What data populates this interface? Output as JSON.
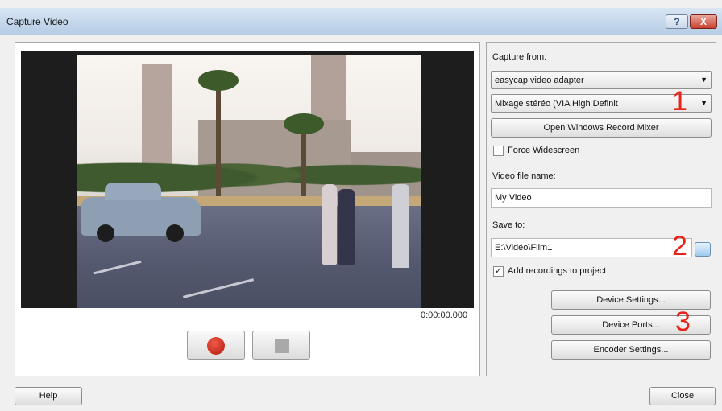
{
  "window": {
    "title": "Capture Video",
    "help_glyph": "?",
    "close_glyph": "X"
  },
  "preview": {
    "timecode": "0:00:00.000"
  },
  "settings": {
    "capture_from_label": "Capture from:",
    "video_source": "easycap video adapter",
    "audio_source": "Mixage stéréo (VIA High Definit",
    "open_mixer_label": "Open Windows Record Mixer",
    "force_widescreen_label": "Force Widescreen",
    "force_widescreen_checked": false,
    "video_file_name_label": "Video file name:",
    "video_file_name": "My Video",
    "save_to_label": "Save to:",
    "save_to_path": "E:\\Vidéo\\Film1",
    "add_recordings_label": "Add recordings to project",
    "add_recordings_checked": true,
    "device_settings_label": "Device Settings...",
    "device_ports_label": "Device Ports...",
    "encoder_settings_label": "Encoder Settings..."
  },
  "annotations": [
    "1",
    "2",
    "3"
  ],
  "footer": {
    "help_label": "Help",
    "close_label": "Close"
  },
  "colors": {
    "annotation": "#e6241a",
    "record": "#d0261a",
    "titlebar": "#c4d7eb"
  }
}
